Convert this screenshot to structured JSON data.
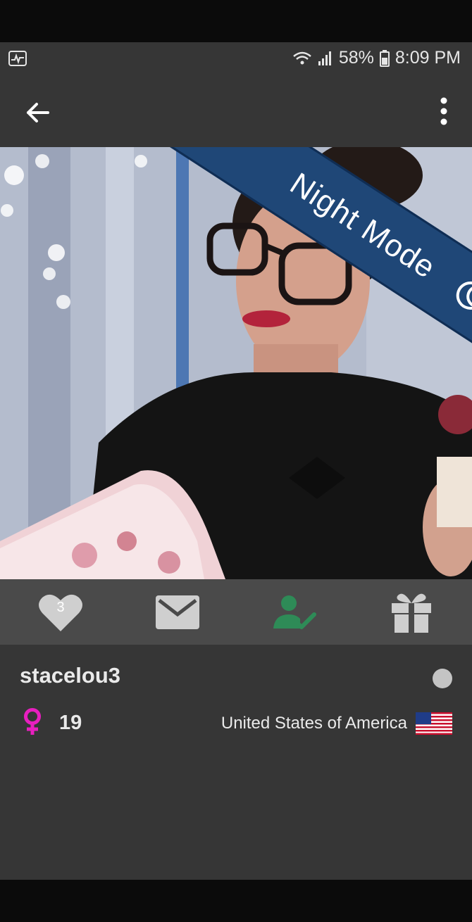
{
  "status_bar": {
    "battery": "58%",
    "time": "8:09 PM",
    "left_icon": "activity-icon",
    "right_icons": [
      "wifi-icon",
      "signal-icon",
      "battery-icon"
    ]
  },
  "app_bar": {
    "back_icon": "back-arrow-icon",
    "menu_icon": "more-vert-icon"
  },
  "overlay": {
    "label": "Night Mode",
    "icon": "moon-icon",
    "color": "#1f4777"
  },
  "actions": {
    "like_count": "3",
    "icons": [
      "heart-icon",
      "mail-icon",
      "friend-added-icon",
      "gift-icon"
    ],
    "friend_color": "#2e8b57"
  },
  "profile": {
    "username": "stacelou3",
    "gender_icon": "female-icon",
    "gender_color": "#e81fbf",
    "age": "19",
    "country": "United States of America",
    "flag_icon": "us-flag-icon",
    "online_status_color": "#c4c4c4"
  }
}
